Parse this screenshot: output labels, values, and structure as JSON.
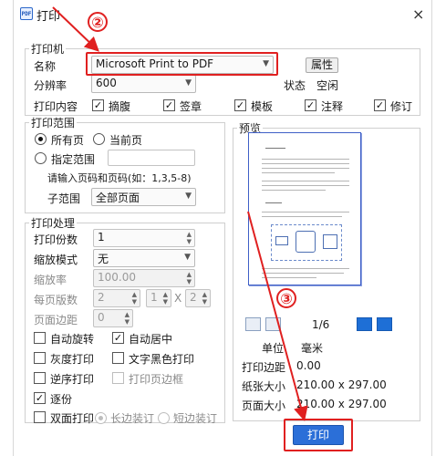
{
  "window": {
    "app_icon": "PDF",
    "title": "打印",
    "close_glyph": "×"
  },
  "printer_group": {
    "legend": "打印机",
    "name_label": "名称",
    "printer_name": "Microsoft Print to PDF",
    "properties_button": "属性",
    "resolution_label": "分辨率",
    "resolution_value": "600",
    "status_label": "状态",
    "status_value": "空闲",
    "content_label": "打印内容",
    "content_options": [
      {
        "label": "摘腹",
        "checked": true
      },
      {
        "label": "签章",
        "checked": true
      },
      {
        "label": "模板",
        "checked": true
      },
      {
        "label": "注释",
        "checked": true
      },
      {
        "label": "修订",
        "checked": true
      }
    ]
  },
  "range_group": {
    "legend": "打印范围",
    "all_pages": "所有页",
    "current_page": "当前页",
    "specified_range": "指定范围",
    "hint": "请输入页码和页码(如：1,3,5-8)",
    "subrange_label": "子范围",
    "subrange_value": "全部页面"
  },
  "processing_group": {
    "legend": "打印处理",
    "copies_label": "打印份数",
    "copies_value": "1",
    "scale_mode_label": "缩放模式",
    "scale_mode_value": "无",
    "scale_label": "缩放率",
    "scale_value": "100.00",
    "pages_per_sheet_label": "每页版数",
    "pages_per_sheet_value": "2",
    "layout_cols": "1",
    "layout_x": "X",
    "layout_rows": "2",
    "margin_label": "页面边距",
    "margin_value": "0",
    "options": {
      "auto_rotate": "自动旋转",
      "auto_center": "自动居中",
      "grayscale": "灰度打印",
      "black_text": "文字黑色打印",
      "reverse": "逆序打印",
      "page_border": "打印页边框",
      "collate": "逐份",
      "duplex": "双面打印",
      "long_edge": "长边装订",
      "short_edge": "短边装订"
    }
  },
  "preview": {
    "label": "预览",
    "page_indicator": "1/6",
    "unit_label": "单位",
    "unit_value": "毫米",
    "margin_label": "打印边距",
    "margin_value": "0.00",
    "paper_label": "纸张大小",
    "paper_value": "210.00 x 297.00",
    "page_label": "页面大小",
    "page_value": "210.00 x 297.00"
  },
  "print_button": "打印",
  "annotations": {
    "step2": "②",
    "step3": "③",
    "color": "#e02020"
  }
}
